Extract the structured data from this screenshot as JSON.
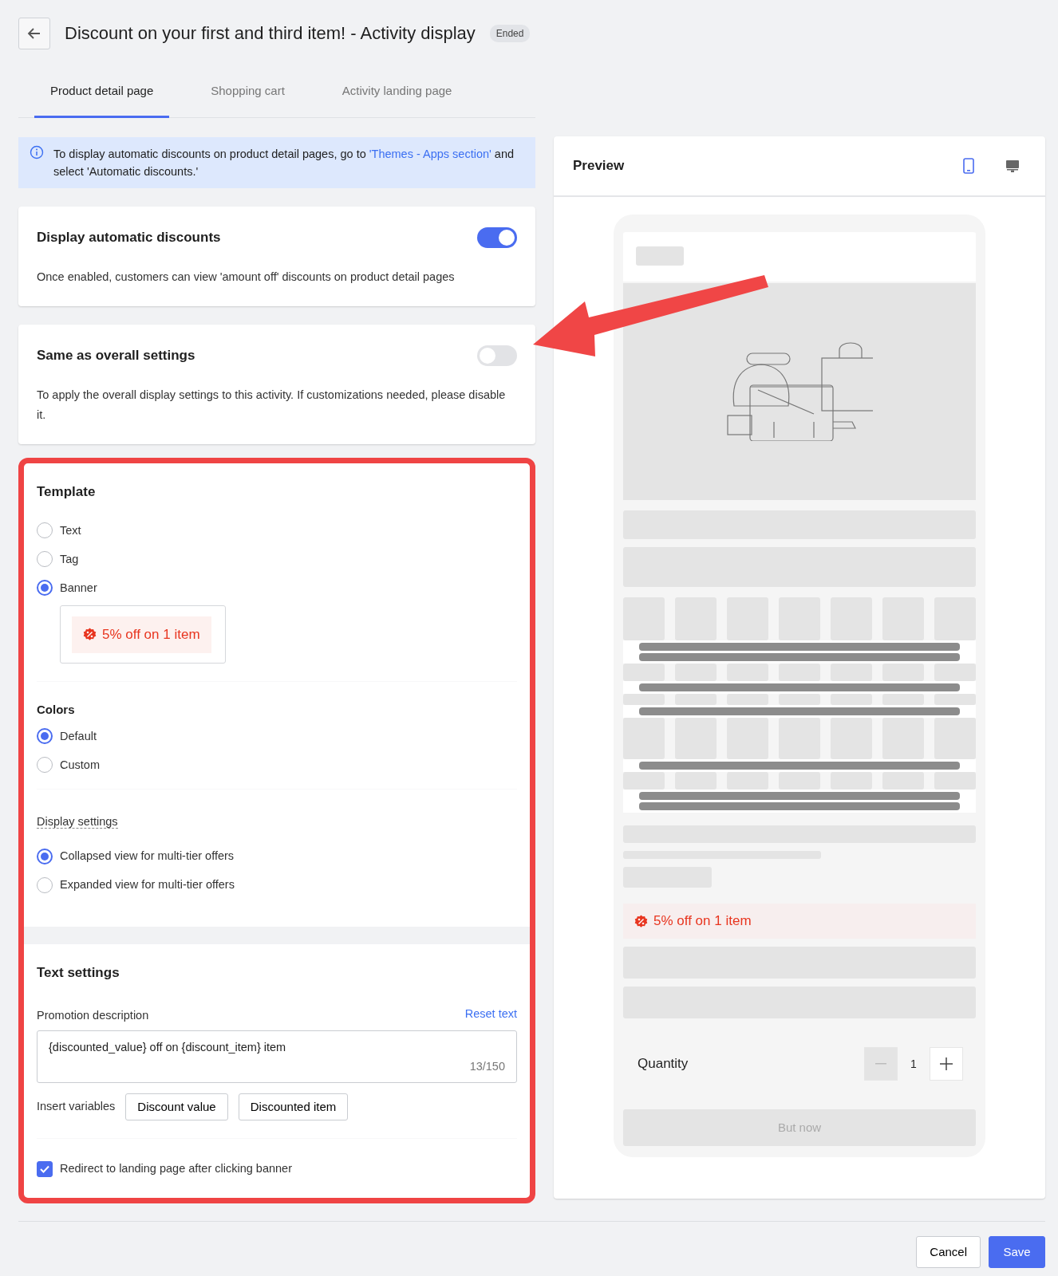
{
  "header": {
    "title": "Discount on your first and third item! - Activity display",
    "status": "Ended"
  },
  "tabs": [
    {
      "label": "Product detail page",
      "selected": true
    },
    {
      "label": "Shopping cart",
      "selected": false
    },
    {
      "label": "Activity landing page",
      "selected": false
    }
  ],
  "notice": {
    "before": "To display automatic discounts on product detail pages, go to ",
    "link": "'Themes - Apps section'",
    "after": " and select 'Automatic discounts.'"
  },
  "toggle_cards": [
    {
      "title": "Display automatic discounts",
      "on": true,
      "description": "Once enabled, customers can view 'amount off' discounts on product detail pages"
    },
    {
      "title": "Same as overall settings",
      "on": false,
      "description": "To apply the overall display settings to this activity. If customizations needed, please disable it."
    }
  ],
  "template": {
    "title": "Template",
    "options": [
      {
        "label": "Text",
        "selected": false
      },
      {
        "label": "Tag",
        "selected": false
      },
      {
        "label": "Banner",
        "selected": true
      }
    ],
    "banner_preview": "5% off on 1 item"
  },
  "colors": {
    "title": "Colors",
    "options": [
      {
        "label": "Default",
        "selected": true
      },
      {
        "label": "Custom",
        "selected": false
      }
    ]
  },
  "display_settings": {
    "title": "Display settings",
    "options": [
      {
        "label": "Collapsed view for multi-tier offers",
        "selected": true
      },
      {
        "label": "Expanded view for multi-tier offers",
        "selected": false
      }
    ]
  },
  "text_settings": {
    "title": "Text settings",
    "field_label": "Promotion description",
    "reset_link": "Reset text",
    "value": "{discounted_value} off on {discount_item} item",
    "counter": "13/150",
    "insert_label": "Insert variables",
    "variables": [
      "Discount value",
      "Discounted item"
    ],
    "redirect": {
      "label": "Redirect to landing page after clicking banner",
      "checked": true
    }
  },
  "preview": {
    "title": "Preview",
    "devices": [
      {
        "kind": "mobile",
        "selected": true
      },
      {
        "kind": "desktop",
        "selected": false
      }
    ],
    "banner": "5% off on 1 item",
    "quantity_label": "Quantity",
    "quantity": "1",
    "buy_button": "But now"
  },
  "footer": {
    "buttons": [
      "Cancel",
      "Save"
    ]
  }
}
